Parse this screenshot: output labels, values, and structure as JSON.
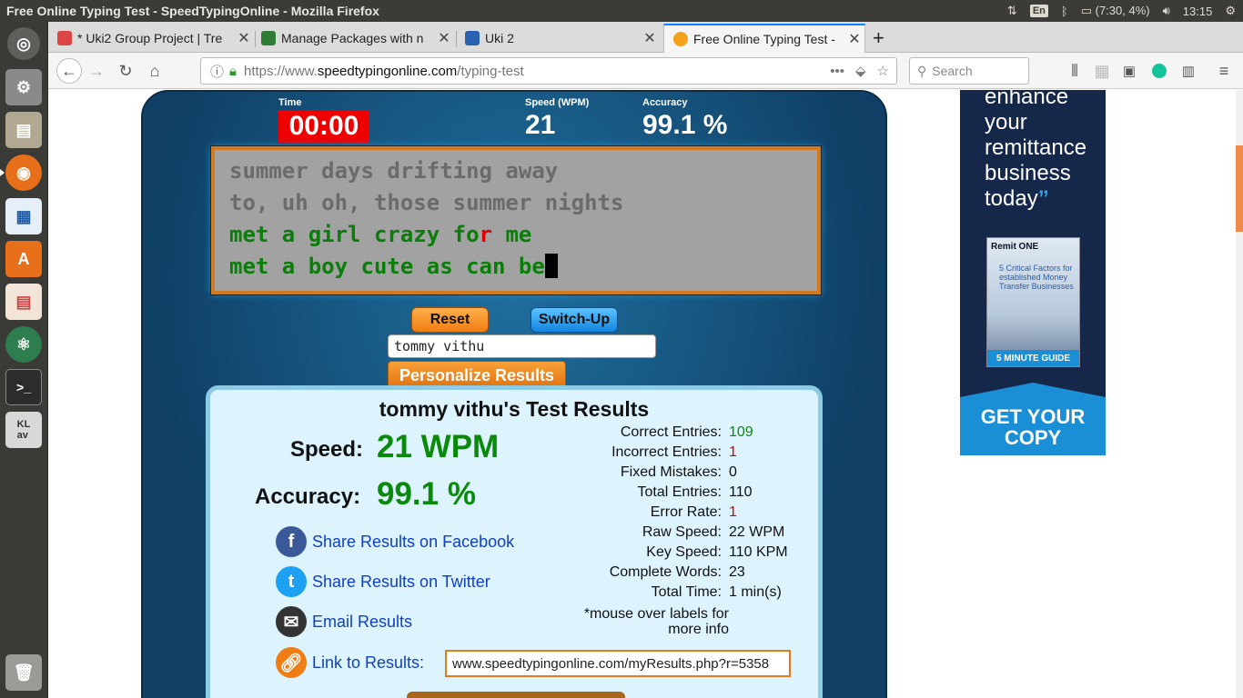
{
  "window": {
    "title": "Free Online Typing Test - SpeedTypingOnline - Mozilla Firefox"
  },
  "tray": {
    "lang": "En",
    "battery": "(7:30, 4%)",
    "clock": "13:15"
  },
  "launcher": [
    "ubuntu-dash-icon",
    "system-settings-icon",
    "files-icon",
    "firefox-icon",
    "writer-icon",
    "software-center-icon",
    "impress-icon",
    "atom-icon",
    "terminal-icon",
    "keyboard-icon",
    "trash-icon"
  ],
  "tabs": [
    {
      "label": "* Uki2 Group Project | Tre"
    },
    {
      "label": "Manage Packages with n"
    },
    {
      "label": "Uki 2"
    },
    {
      "label": "Free Online Typing Test -"
    }
  ],
  "nav": {
    "url_prefix": "https://www.",
    "url_domain": "speedtypingonline.com",
    "url_path": "/typing-test",
    "search_placeholder": "Search"
  },
  "stats": {
    "time_label": "Time",
    "time": "00:00",
    "speed_label": "Speed (WPM)",
    "speed": "21",
    "accuracy_label": "Accuracy",
    "accuracy": "99.1 %"
  },
  "typing": {
    "line1": "summer days drifting away",
    "line2": "to, uh oh, those summer nights",
    "line3_a": "met a girl crazy fo",
    "line3_err": "r",
    "line3_b": " me",
    "line4": "met a boy cute as can be"
  },
  "controls": {
    "reset": "Reset",
    "switch_up": "Switch-Up",
    "name_value": "tommy vithu",
    "personalize": "Personalize Results"
  },
  "results": {
    "title": "tommy vithu's Test Results",
    "speed_label": "Speed:",
    "speed": "21 WPM",
    "accuracy_label": "Accuracy:",
    "accuracy": "99.1 %",
    "stats": [
      {
        "label": "Correct Entries:",
        "value": "109",
        "color": "#0a8a0a"
      },
      {
        "label": "Incorrect Entries:",
        "value": "1",
        "color": "#d00000"
      },
      {
        "label": "Fixed Mistakes:",
        "value": "0",
        "color": "#111111"
      },
      {
        "label": "Total Entries:",
        "value": "110",
        "color": "#111111"
      },
      {
        "label": "Error Rate:",
        "value": "1",
        "color": "#d00000"
      },
      {
        "label": "Raw Speed:",
        "value": "22 WPM",
        "color": "#111111"
      },
      {
        "label": "Key Speed:",
        "value": "110 KPM",
        "color": "#111111"
      },
      {
        "label": "Complete Words:",
        "value": "23",
        "color": "#111111"
      },
      {
        "label": "Total Time:",
        "value": "1 min(s)",
        "color": "#111111"
      }
    ],
    "note": "*mouse over labels for more info",
    "share_facebook": "Share Results on Facebook",
    "share_twitter": "Share Results on Twitter",
    "email": "Email Results",
    "link_label": "Link to Results:",
    "link_value": "www.speedtypingonline.com/myResults.php?r=5358"
  },
  "ad": {
    "quote": "enhance your remittance business today",
    "book_brand": "Remit ONE",
    "book_desc": "5 Critical Factors for established Money Transfer Businesses",
    "book_footer": "5 MINUTE GUIDE",
    "cta": "GET YOUR COPY"
  }
}
